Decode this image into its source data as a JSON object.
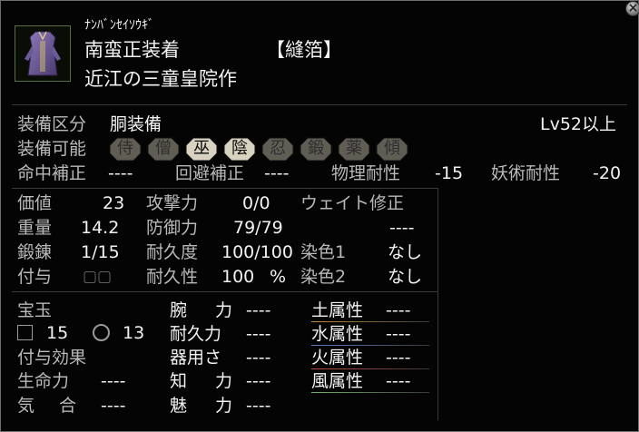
{
  "window": {
    "close_label": "×"
  },
  "item": {
    "reading": "ﾅﾝﾊﾞﾝｾｲｿｳｷﾞ",
    "name": "南蛮正装着",
    "category": "【縫箔】",
    "maker": "近江の三童皇院作",
    "icon": "robe-icon"
  },
  "equip": {
    "slot_label": "装備区分",
    "slot_value": "胴装備",
    "level_req": "Lv52以上",
    "class_label": "装備可能",
    "classes": [
      {
        "label": "侍",
        "enabled": false
      },
      {
        "label": "僧",
        "enabled": false
      },
      {
        "label": "巫",
        "enabled": true
      },
      {
        "label": "陰",
        "enabled": true
      },
      {
        "label": "忍",
        "enabled": false
      },
      {
        "label": "鍛",
        "enabled": false
      },
      {
        "label": "薬",
        "enabled": false
      },
      {
        "label": "傾",
        "enabled": false
      }
    ],
    "badge_on_color": "#d8d2c0",
    "badge_off_color": "#5f5d54"
  },
  "mods": {
    "hit_label": "命中補正",
    "hit_value": "----",
    "evade_label": "回避補正",
    "evade_value": "----",
    "phys_label": "物理耐性",
    "phys_value": "-15",
    "magic_label": "妖術耐性",
    "magic_value": "-20"
  },
  "stats": {
    "price_label": "価値",
    "price_value": "23",
    "attack_label": "攻撃力",
    "attack_value": "0/0",
    "weight_mod_label": "ウェイト修正",
    "weight_mod_value": "----",
    "weight_label": "重量",
    "weight_value": "14.2",
    "defense_label": "防御力",
    "defense_value": "79/79",
    "forge_label": "鍛錬",
    "forge_value": "1/15",
    "durability_label": "耐久度",
    "durability_value": "100/100",
    "dye1_label": "染色1",
    "dye1_value": "なし",
    "grant_label": "付与",
    "grant_slots": "▢▢",
    "durability_pct_label": "耐久性",
    "durability_pct_value": "100",
    "durability_pct_unit": "%",
    "dye2_label": "染色2",
    "dye2_value": "なし"
  },
  "gems": {
    "label": "宝玉",
    "square_count": "15",
    "circle_count": "13",
    "effect_label": "付与効果"
  },
  "bonus": {
    "hp_label": "生命力",
    "hp_value": "----",
    "ki_label1": "気",
    "ki_label2": "合",
    "ki_value": "----",
    "arm_label1": "腕",
    "arm_label2": "力",
    "arm_value": "----",
    "stamina_label": "耐久力",
    "stamina_value": "----",
    "dex_label": "器用さ",
    "dex_value": "----",
    "int_label1": "知",
    "int_label2": "力",
    "int_value": "----",
    "charm_label1": "魅",
    "charm_label2": "力",
    "charm_value": "----"
  },
  "elements": [
    {
      "label": "土属性",
      "value": "----",
      "color": "#c08a3c"
    },
    {
      "label": "水属性",
      "value": "----",
      "color": "#5a7fc8"
    },
    {
      "label": "火属性",
      "value": "----",
      "color": "#c44a3a"
    },
    {
      "label": "風属性",
      "value": "----",
      "color": "#6fb26a"
    }
  ]
}
